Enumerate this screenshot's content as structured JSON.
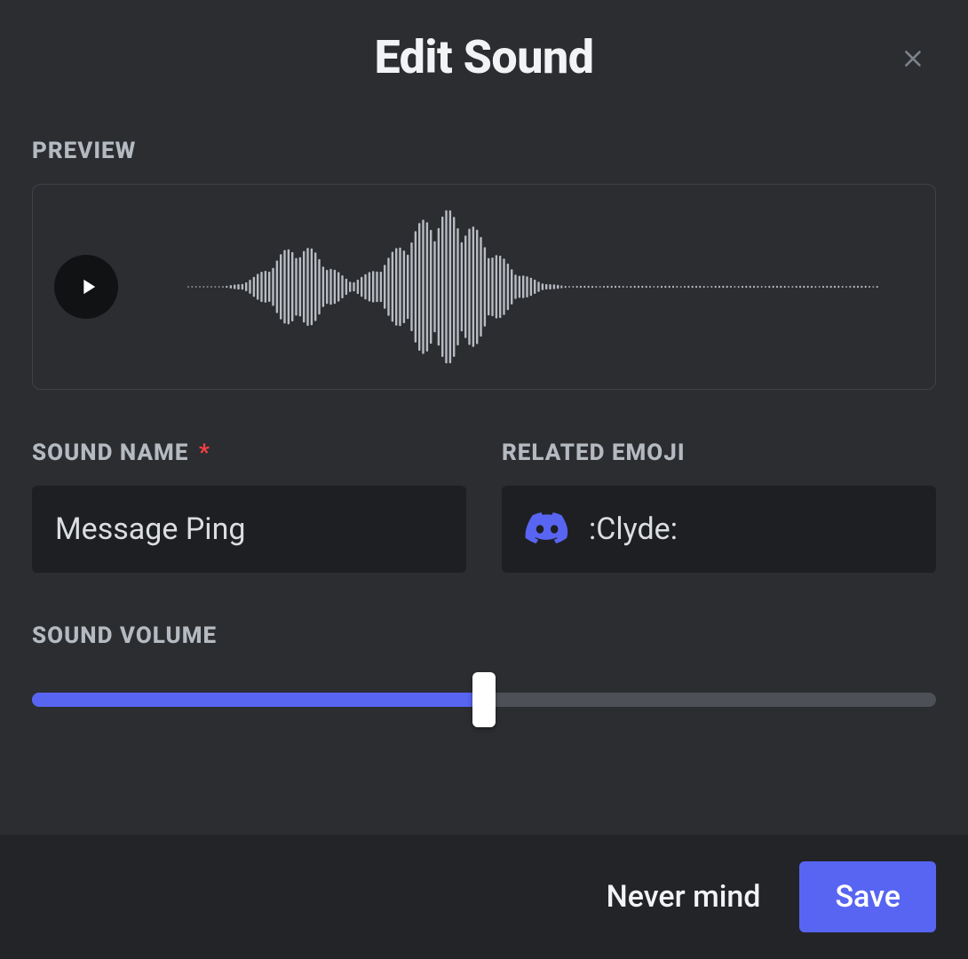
{
  "modal": {
    "title": "Edit Sound"
  },
  "labels": {
    "preview": "PREVIEW",
    "sound_name": "SOUND NAME",
    "related_emoji": "RELATED EMOJI",
    "sound_volume": "SOUND VOLUME",
    "required_mark": "*"
  },
  "fields": {
    "sound_name_value": "Message Ping",
    "emoji_text": ":Clyde:"
  },
  "volume": {
    "percent": 50
  },
  "footer": {
    "cancel": "Never mind",
    "save": "Save"
  },
  "colors": {
    "accent": "#5865f2"
  },
  "icons": {
    "close": "close-icon",
    "play": "play-icon",
    "clyde": "clyde-icon"
  }
}
